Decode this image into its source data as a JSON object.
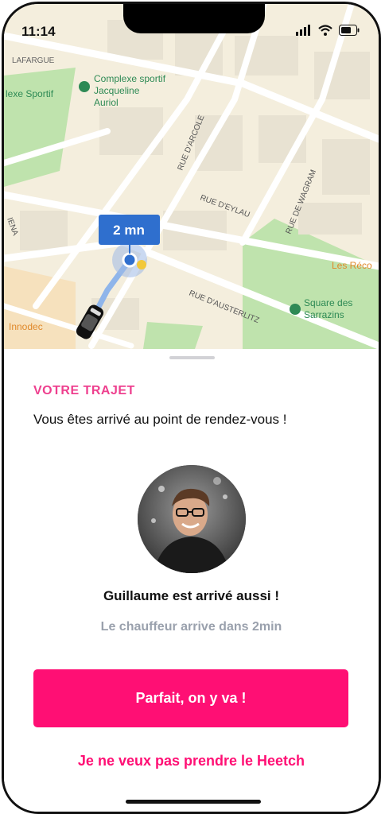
{
  "status_bar": {
    "time": "11:14"
  },
  "map": {
    "labels": {
      "lafargue": "LAFARGUE",
      "complexe_left": "lexe Sportif",
      "complexe_line1": "Complexe sportif",
      "complexe_line2": "Jacqueline",
      "complexe_line3": "Auriol",
      "rue_arcole": "RUE D'ARCOLE",
      "rue_wagram": "RUE DE WAGRAM",
      "rue_eylau": "RUE D'EYLAU",
      "rue_austerlitz": "RUE D'AUSTERLITZ",
      "iena": "IENA",
      "les_reco": "Les Réco",
      "square_line1": "Square des",
      "square_line2": "Sarrazins",
      "innodec": "Innodec"
    },
    "eta_badge": "2 mn"
  },
  "sheet": {
    "section_title": "VOTRE TRAJET",
    "arrival_message": "Vous êtes arrivé au point de rendez-vous !",
    "driver_status": "Guillaume est arrivé aussi !",
    "eta_message": "Le chauffeur arrive dans 2min",
    "primary_button": "Parfait, on y va !",
    "secondary_link": "Je ne veux pas prendre le Heetch"
  },
  "colors": {
    "accent": "#ff0f74",
    "section_title": "#ee3f8e",
    "map_badge": "#2f6fce",
    "park": "#b8dfa4",
    "map_background": "#f4eedd"
  }
}
